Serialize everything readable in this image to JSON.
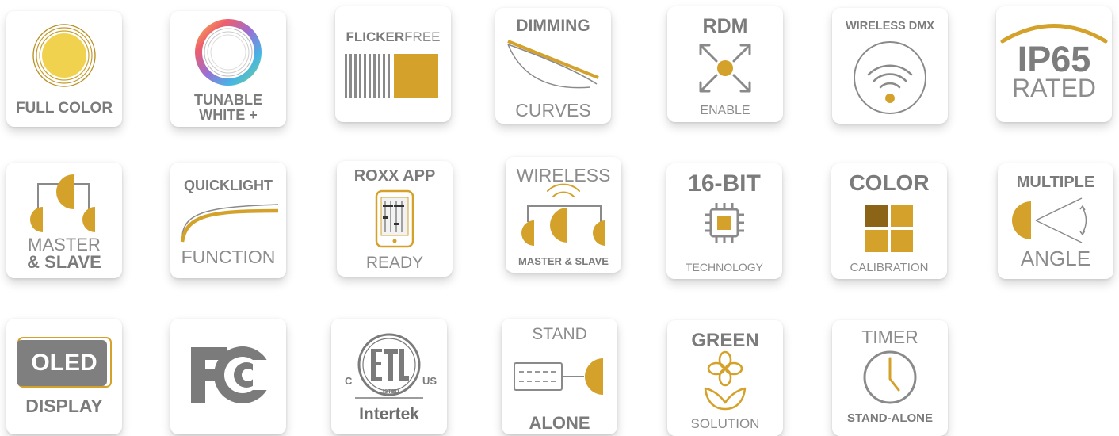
{
  "colors": {
    "gold": "#d4a12a",
    "gray": "#808080",
    "dark_gold": "#8c6417"
  },
  "badges": [
    {
      "id": "full-color",
      "lines": [
        "FULL COLOR"
      ],
      "icon": "full-color-circle-icon"
    },
    {
      "id": "tunable-white",
      "lines": [
        "TUNABLE",
        "WHITE +"
      ],
      "icon": "rainbow-ring-icon"
    },
    {
      "id": "flicker-free",
      "bold": "FLICKER",
      "light": "FREE",
      "icon": "flicker-stripes-icon"
    },
    {
      "id": "dimming-curves",
      "lines": [
        "DIMMING",
        "CURVES"
      ],
      "icon": "dimming-curve-icon"
    },
    {
      "id": "rdm-enable",
      "lines": [
        "RDM",
        "ENABLE"
      ],
      "icon": "rdm-arrows-icon"
    },
    {
      "id": "wireless-dmx",
      "lines": [
        "WIRELESS DMX"
      ],
      "icon": "wifi-icon"
    },
    {
      "id": "ip65-rated",
      "lines": [
        "IP65",
        "RATED"
      ],
      "icon": "ip-arc-icon"
    },
    {
      "id": "master-slave",
      "lines": [
        "MASTER",
        "& SLAVE"
      ],
      "icon": "master-slave-lamps-icon"
    },
    {
      "id": "quicklight-function",
      "lines": [
        "QUICKLIGHT",
        "FUNCTION"
      ],
      "icon": "quicklight-curve-icon"
    },
    {
      "id": "roxx-app",
      "lines": [
        "ROXX APP",
        "READY"
      ],
      "icon": "phone-mixer-icon"
    },
    {
      "id": "wireless-master-slave",
      "lines": [
        "WIRELESS",
        "MASTER & SLAVE"
      ],
      "icon": "wireless-lamps-icon"
    },
    {
      "id": "16-bit",
      "lines": [
        "16-BIT",
        "TECHNOLOGY"
      ],
      "icon": "chip-icon"
    },
    {
      "id": "color-calibration",
      "lines": [
        "COLOR",
        "CALIBRATION"
      ],
      "icon": "color-squares-icon"
    },
    {
      "id": "multiple-angle",
      "lines": [
        "MULTIPLE",
        "ANGLE"
      ],
      "icon": "beam-angle-icon"
    },
    {
      "id": "oled-display",
      "lines": [
        "OLED",
        "DISPLAY"
      ],
      "icon": "oled-screen-icon"
    },
    {
      "id": "fc",
      "lines": [],
      "icon": "fcc-logo-icon"
    },
    {
      "id": "etl-listed",
      "lines": [
        "C",
        "US",
        "LISTED",
        "Intertek"
      ],
      "icon": "etl-logo-icon"
    },
    {
      "id": "stand-alone",
      "lines": [
        "STAND",
        "ALONE"
      ],
      "icon": "keyboard-lamp-icon"
    },
    {
      "id": "green-solution",
      "lines": [
        "GREEN",
        "SOLUTION"
      ],
      "icon": "flower-icon"
    },
    {
      "id": "timer",
      "lines": [
        "TIMER",
        "STAND-ALONE"
      ],
      "icon": "clock-icon"
    }
  ]
}
